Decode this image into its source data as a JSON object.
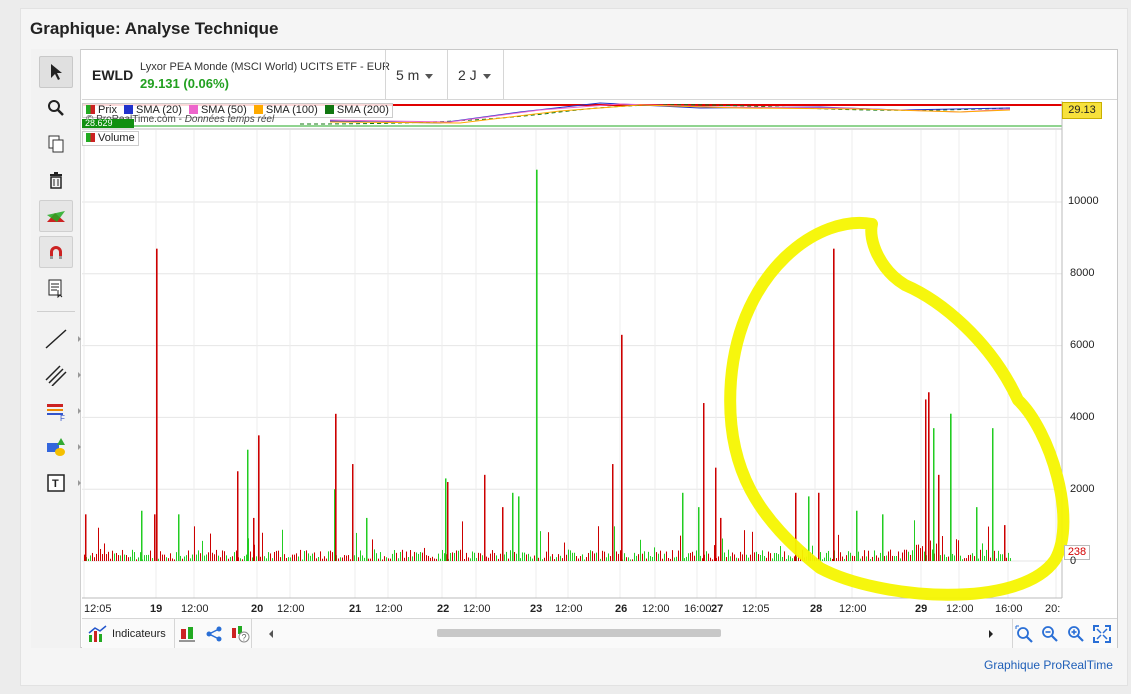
{
  "page": {
    "title": "Graphique: Analyse Technique",
    "footer_link": "Graphique ProRealTime"
  },
  "header": {
    "ticker": "EWLD",
    "name": "Lyxor PEA Monde (MSCI World) UCITS ETF - EUR",
    "quote": "29.131 (0.06%)",
    "interval": "5 m",
    "period": "2 J"
  },
  "legend": {
    "items": [
      {
        "label": "Prix",
        "color": "#22aa22"
      },
      {
        "label": "SMA (20)",
        "color": "#2233cc"
      },
      {
        "label": "SMA (50)",
        "color": "#ee66cc"
      },
      {
        "label": "SMA (100)",
        "color": "#ffaa00"
      },
      {
        "label": "SMA (200)",
        "color": "#117711"
      }
    ],
    "volume_label": "Volume",
    "volume_color": "#22aa22"
  },
  "credit": {
    "source": "© ProRealTime.com - ",
    "rt": "Données temps réel"
  },
  "price": {
    "current": "29.13",
    "badge_low": "28.629"
  },
  "volume": {
    "current": "238"
  },
  "y_ticks": [
    "10000",
    "8000",
    "6000",
    "4000",
    "2000",
    "0"
  ],
  "x_ticks": [
    {
      "label": "12:05",
      "bold": false
    },
    {
      "label": "19",
      "bold": true
    },
    {
      "label": "12:00",
      "bold": false
    },
    {
      "label": "20",
      "bold": true
    },
    {
      "label": "12:00",
      "bold": false
    },
    {
      "label": "21",
      "bold": true
    },
    {
      "label": "12:00",
      "bold": false
    },
    {
      "label": "22",
      "bold": true
    },
    {
      "label": "12:00",
      "bold": false
    },
    {
      "label": "23",
      "bold": true
    },
    {
      "label": "12:00",
      "bold": false
    },
    {
      "label": "26",
      "bold": true
    },
    {
      "label": "12:00",
      "bold": false
    },
    {
      "label": "16:00",
      "bold": false
    },
    {
      "label": "27",
      "bold": true
    },
    {
      "label": "12:05",
      "bold": false
    },
    {
      "label": "28",
      "bold": true
    },
    {
      "label": "12:00",
      "bold": false
    },
    {
      "label": "29",
      "bold": true
    },
    {
      "label": "12:00",
      "bold": false
    },
    {
      "label": "16:00",
      "bold": false
    },
    {
      "label": "20:",
      "bold": false
    }
  ],
  "bottom": {
    "indicators_label": "Indicateurs"
  },
  "colors": {
    "up": "#22cc22",
    "down": "#cc0000",
    "highlight": "#f5f500"
  },
  "chart_data": {
    "type": "bar",
    "title": "",
    "series_name": "Volume",
    "ylim": [
      0,
      11000
    ],
    "y_ticks": [
      0,
      2000,
      4000,
      6000,
      8000,
      10000
    ],
    "notable_spikes": [
      {
        "x": "19",
        "value": 8700,
        "direction": "down"
      },
      {
        "x": "20",
        "value": 3500,
        "direction": "down"
      },
      {
        "x": "21",
        "value": 4100,
        "direction": "down"
      },
      {
        "x": "23",
        "value": 10900,
        "direction": "up"
      },
      {
        "x": "26",
        "value": 6300,
        "direction": "down"
      },
      {
        "x": "28",
        "value": 8700,
        "direction": "down"
      },
      {
        "x": "29",
        "value": 4700,
        "direction": "down"
      },
      {
        "x": "29",
        "value": 4100,
        "direction": "up"
      }
    ],
    "last_value": 238
  }
}
